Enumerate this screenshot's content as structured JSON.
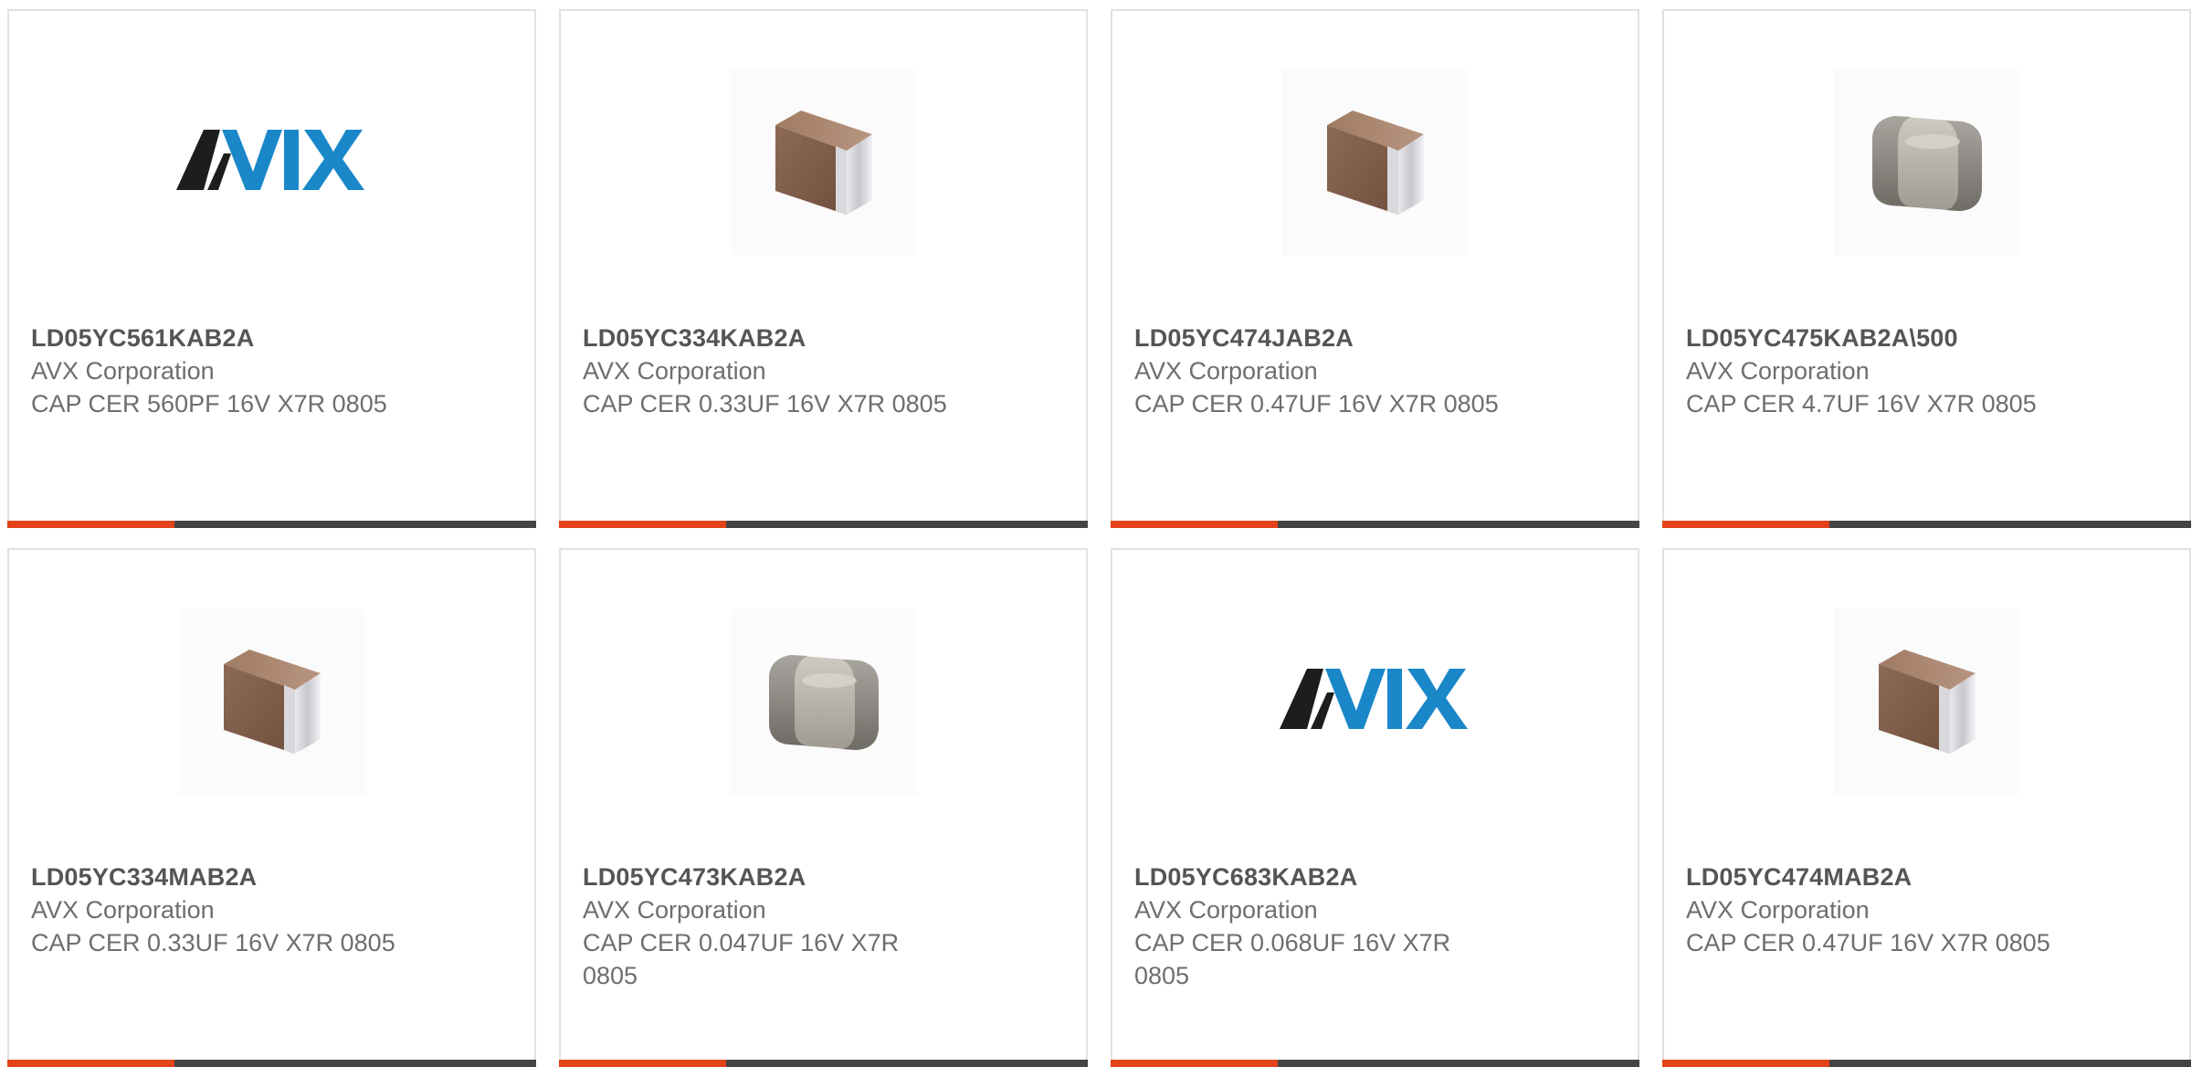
{
  "colors": {
    "accent": "#e2431a",
    "bar": "#444444",
    "card_border": "#e1e1e1",
    "part_text": "#555555",
    "meta_text": "#6e6e6e",
    "avx_dark": "#1d1d1b",
    "avx_blue": "#1a87c9"
  },
  "products": [
    {
      "part": "LD05YC561KAB2A",
      "manufacturer": "AVX Corporation",
      "description": "CAP CER 560PF 16V X7R 0805",
      "image": "avx-logo"
    },
    {
      "part": "LD05YC334KAB2A",
      "manufacturer": "AVX Corporation",
      "description": "CAP CER 0.33UF 16V X7R 0805",
      "image": "chip-capacitor-brown"
    },
    {
      "part": "LD05YC474JAB2A",
      "manufacturer": "AVX Corporation",
      "description": "CAP CER 0.47UF 16V X7R 0805",
      "image": "chip-capacitor-brown"
    },
    {
      "part": "LD05YC475KAB2A\\500",
      "manufacturer": "AVX Corporation",
      "description": "CAP CER 4.7UF 16V X7R 0805",
      "image": "chip-capacitor-grey"
    },
    {
      "part": "LD05YC334MAB2A",
      "manufacturer": "AVX Corporation",
      "description": "CAP CER 0.33UF 16V X7R 0805",
      "image": "chip-capacitor-brown"
    },
    {
      "part": "LD05YC473KAB2A",
      "manufacturer": "AVX Corporation",
      "description": "CAP CER 0.047UF 16V X7R 0805",
      "image": "chip-capacitor-grey"
    },
    {
      "part": "LD05YC683KAB2A",
      "manufacturer": "AVX Corporation",
      "description": "CAP CER 0.068UF 16V X7R 0805",
      "image": "avx-logo"
    },
    {
      "part": "LD05YC474MAB2A",
      "manufacturer": "AVX Corporation",
      "description": "CAP CER 0.47UF 16V X7R 0805",
      "image": "chip-capacitor-brown"
    }
  ]
}
